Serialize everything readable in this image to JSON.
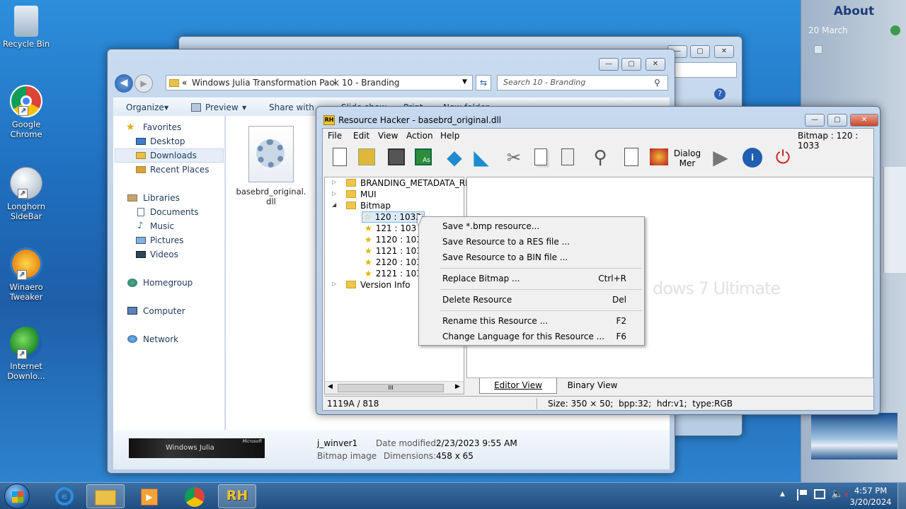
{
  "desktop": {
    "icons": [
      {
        "label": "Recycle Bin"
      },
      {
        "label": "Google Chrome"
      },
      {
        "label": "Longhorn SideBar"
      },
      {
        "label": "Winaero Tweaker"
      },
      {
        "label": "Internet Downlo..."
      }
    ]
  },
  "sidebar": {
    "title": "About",
    "date": "20 March"
  },
  "explorer": {
    "address": {
      "prefix": "«",
      "path1": "Windows Julia Transformation Pack",
      "sep": "›",
      "path2": "10 - Branding"
    },
    "search_placeholder": "Search 10 - Branding",
    "toolbar": {
      "organize": "Organize",
      "preview": "Preview",
      "share": "Share with",
      "slideshow": "Slide show",
      "print": "Print",
      "newfolder": "New folder"
    },
    "nav": {
      "favorites": "Favorites",
      "desktop": "Desktop",
      "downloads": "Downloads",
      "recent": "Recent Places",
      "libraries": "Libraries",
      "documents": "Documents",
      "music": "Music",
      "pictures": "Pictures",
      "videos": "Videos",
      "homegroup": "Homegroup",
      "computer": "Computer",
      "network": "Network"
    },
    "file": {
      "name": "basebrd_original.dll"
    },
    "details": {
      "name": "j_winver1",
      "type": "Bitmap image",
      "modified_label": "Date modified:",
      "modified": "2/23/2023 9:55 AM",
      "dims_label": "Dimensions:",
      "dims": "458 x 65",
      "preview_text": "Windows Julia",
      "preview_brand": "Microsoft"
    }
  },
  "rh": {
    "title": "Resource Hacker - basebrd_original.dll",
    "menu": {
      "file": "File",
      "edit": "Edit",
      "view": "View",
      "action": "Action",
      "help": "Help"
    },
    "right_info": "Bitmap : 120 : 1033",
    "dialog_btn": "Dialog Mer",
    "tree": {
      "n1": "BRANDING_METADATA_RE",
      "n2": "MUI",
      "n3": "Bitmap",
      "n4": "120 : 1033",
      "n5": "121 : 103",
      "n6": "1120 : 103",
      "n7": "1121 : 103",
      "n8": "2120 : 103",
      "n9": "2121 : 103",
      "n10": "Version Info"
    },
    "watermark": "dows 7 Ultimate",
    "tabs": {
      "editor": "Editor View",
      "binary": "Binary View"
    },
    "status": {
      "left": "1119A / 818",
      "right": "Size: 350 × 50;  bpp:32;  hdr:v1;  type:RGB"
    }
  },
  "context_menu": {
    "items": [
      {
        "label": "Save *.bmp resource...",
        "key": ""
      },
      {
        "label": "Save Resource to a RES file ...",
        "key": ""
      },
      {
        "label": "Save Resource to a BIN file ...",
        "key": ""
      },
      {
        "label": "Replace Bitmap ...",
        "key": "Ctrl+R"
      },
      {
        "label": "Delete Resource",
        "key": "Del"
      },
      {
        "label": "Rename this Resource ...",
        "key": "F2"
      },
      {
        "label": "Change Language for this Resource ...",
        "key": "F6"
      }
    ]
  },
  "taskbar": {
    "time": "4:57 PM",
    "date": "3/20/2024",
    "rh_label": "RH"
  }
}
